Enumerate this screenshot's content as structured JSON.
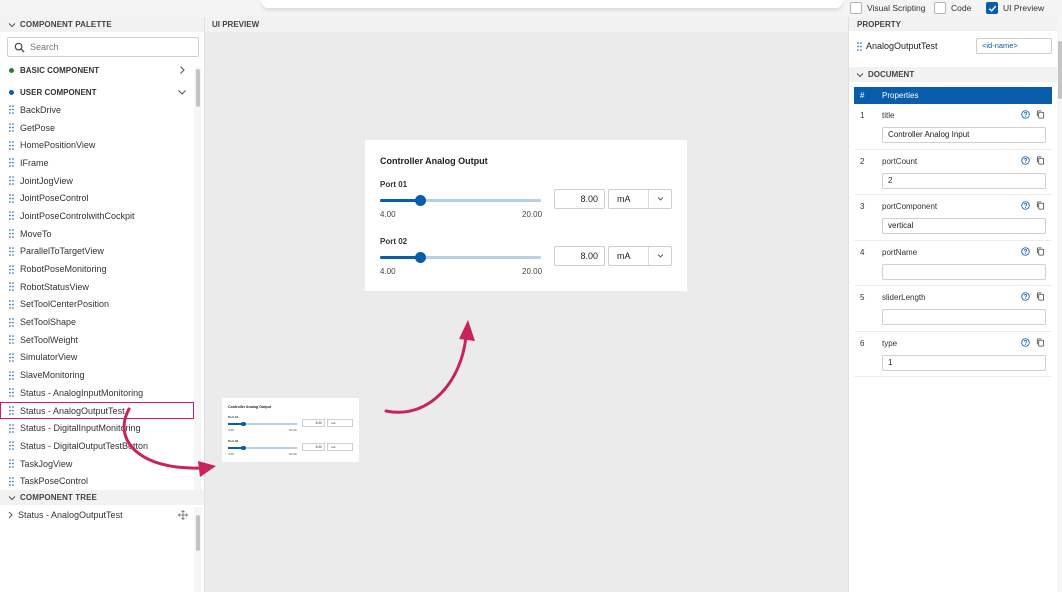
{
  "topbar": {
    "visual_scripting": {
      "label": "Visual Scripting",
      "checked": false
    },
    "code": {
      "label": "Code",
      "checked": false
    },
    "ui_preview": {
      "label": "UI Preview",
      "checked": true
    }
  },
  "palette": {
    "header": "COMPONENT PALETTE",
    "search_placeholder": "Search",
    "basic": {
      "label": "BASIC COMPONENT",
      "dot_color": "#2e7d32"
    },
    "user": {
      "label": "USER COMPONENT",
      "dot_color": "#0a5cad"
    },
    "items": [
      "BackDrive",
      "GetPose",
      "HomePositionView",
      "IFrame",
      "JointJogView",
      "JointPoseControl",
      "JointPoseControlwithCockpit",
      "MoveTo",
      "ParallelToTargetView",
      "RobotPoseMonitoring",
      "RobotStatusView",
      "SetToolCenterPosition",
      "SetToolShape",
      "SetToolWeight",
      "SimulatorView",
      "SlaveMonitoring",
      "Status - AnalogInputMonitoring",
      "Status - AnalogOutputTest",
      "Status - DigitalInputMonitoring",
      "Status - DigitalOutputTestButton",
      "TaskJogView",
      "TaskPoseControl"
    ],
    "selected_index": 17
  },
  "tree": {
    "header": "COMPONENT TREE",
    "root": "Status - AnalogOutputTest"
  },
  "preview": {
    "header": "UI PREVIEW",
    "card": {
      "title": "Controller Analog Output",
      "ports": [
        {
          "label": "Port 01",
          "value": "8.00",
          "unit": "mA",
          "min": "4.00",
          "max": "20.00",
          "level": 0.25
        },
        {
          "label": "Port 02",
          "value": "8.00",
          "unit": "mA",
          "min": "4.00",
          "max": "20.00",
          "level": 0.25
        }
      ]
    }
  },
  "property": {
    "header": "PROPERTY",
    "component_name": "AnalogOutputTest",
    "id_placeholder": "<id-name>",
    "document_header": "DOCUMENT",
    "columns": [
      "#",
      "Properties"
    ],
    "rows": [
      {
        "index": "1",
        "name": "title",
        "value": "Controller Analog Input"
      },
      {
        "index": "2",
        "name": "portCount",
        "value": "2"
      },
      {
        "index": "3",
        "name": "portComponent",
        "value": "vertical"
      },
      {
        "index": "4",
        "name": "portName",
        "value": ""
      },
      {
        "index": "5",
        "name": "sliderLength",
        "value": ""
      },
      {
        "index": "6",
        "name": "type",
        "value": "1"
      }
    ]
  },
  "colors": {
    "accent": "#0a5cad",
    "highlight": "#c8235b",
    "slider_track": "#b9cfe6"
  }
}
